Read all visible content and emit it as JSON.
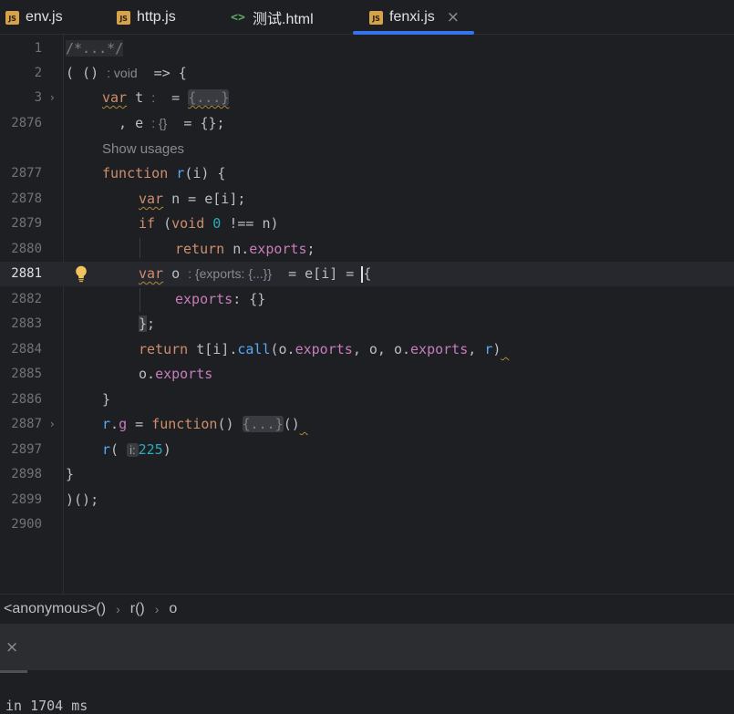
{
  "tabs": [
    {
      "label": "env.js",
      "icon": "js-file-icon",
      "icon_text": "JS"
    },
    {
      "label": "http.js",
      "icon": "js-file-icon",
      "icon_text": "JS"
    },
    {
      "label": "测试.html",
      "icon": "html-file-icon",
      "icon_text": "<>"
    },
    {
      "label": "fenxi.js",
      "icon": "js-file-icon",
      "icon_text": "JS",
      "active": true,
      "close": "×"
    }
  ],
  "editor": {
    "line_numbers": [
      "1",
      "2",
      "3",
      "2876",
      "2877",
      "2878",
      "2879",
      "2880",
      "2881",
      "2882",
      "2883",
      "2884",
      "2885",
      "2886",
      "2887",
      "2897",
      "2898",
      "2899",
      "2900"
    ],
    "current_line": "2881",
    "show_usages": "Show usages",
    "fold_placeholder": "{...}",
    "comment_fold": "/*...*/",
    "hints": {
      "void": ": void",
      "t_colon": ":",
      "e_type": ": {}",
      "o_type": ": {exports: {...}}",
      "param_i": "i:"
    },
    "numbers": {
      "zero": "0",
      "arg": "225"
    }
  },
  "breadcrumb": [
    "<anonymous>()",
    "r()",
    "o"
  ],
  "panel": {
    "close": "×",
    "output": "in 1704 ms"
  },
  "colors": {
    "accent": "#3574f0",
    "keyword": "#cf8e6d",
    "function": "#57aaf7",
    "property": "#c77dbb",
    "number": "#2aacb8"
  }
}
